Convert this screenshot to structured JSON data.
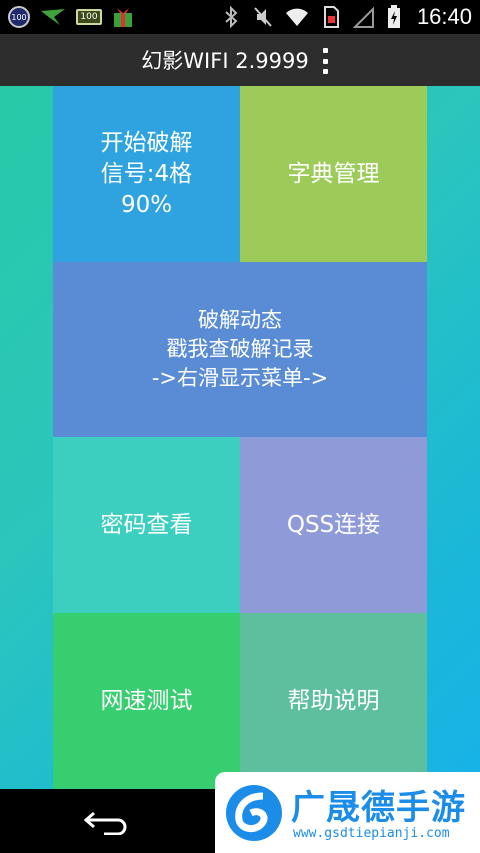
{
  "status_bar": {
    "notif_badge_1": "100",
    "notif_badge_2": "100",
    "icons": [
      "bird-icon",
      "gift-icon",
      "bluetooth-icon",
      "mute-icon",
      "wifi-icon",
      "sim-icon",
      "signal-icon",
      "battery-icon"
    ],
    "time": "16:40"
  },
  "titlebar": {
    "title": "幻影WIFI 2.9999",
    "overflow_icon": "overflow-menu-icon"
  },
  "tiles": {
    "crack": {
      "line1": "开始破解",
      "line2": "信号:4格",
      "line3": "90%"
    },
    "dictionary": {
      "label": "字典管理"
    },
    "dynamics": {
      "line1": "破解动态",
      "line2": "戳我查破解记录",
      "line3": "->右滑显示菜单->"
    },
    "password": {
      "label": "密码查看"
    },
    "qss": {
      "label": "QSS连接"
    },
    "speedtest": {
      "label": "网速测试"
    },
    "help": {
      "label": "帮助说明"
    }
  },
  "colors": {
    "tile_crack": "#2fa3e0",
    "tile_dictionary": "#9ccb5a",
    "tile_dynamics": "#5a8cd6",
    "tile_password": "#3ccfbf",
    "tile_qss": "#8f9ad8",
    "tile_speedtest": "#36ce6e",
    "tile_help": "#5dbf9e",
    "watermark": "#1b8de8"
  },
  "navbar": {
    "back_icon": "back-arrow-icon"
  },
  "watermark": {
    "name": "广晟德手游",
    "url": "www.gsdtiepianji.com"
  }
}
